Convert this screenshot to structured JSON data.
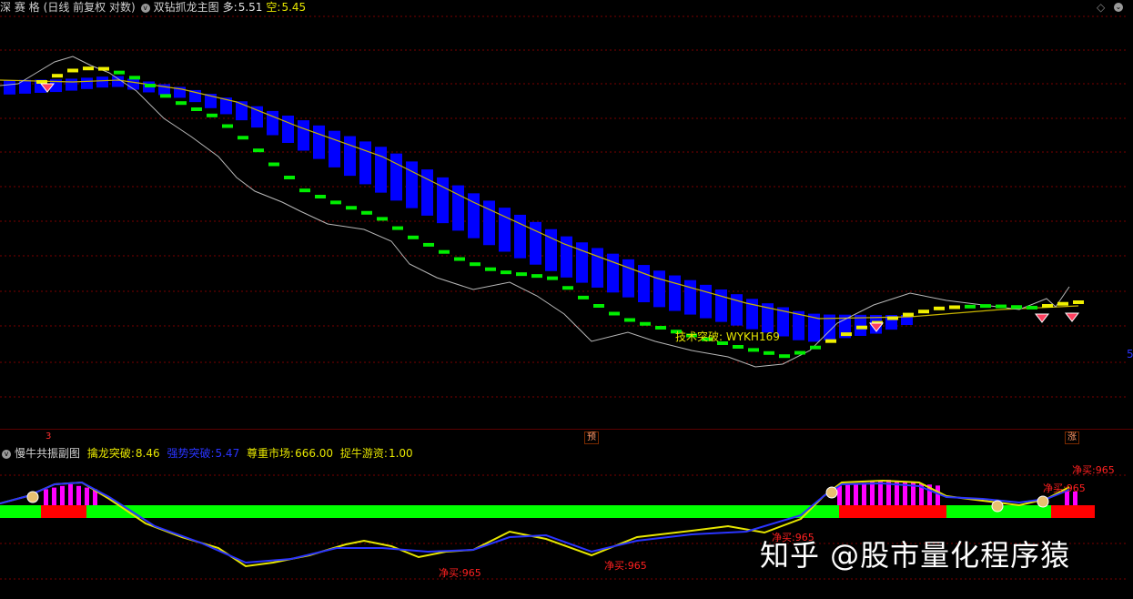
{
  "main_header": {
    "symbol_label": "深 赛 格",
    "mode_label": "(日线 前复权 对数)",
    "indicator_name": "双钻抓龙主图",
    "duo_label": "多:",
    "duo_value": "5.51",
    "kong_label": "空:",
    "kong_value": "5.45"
  },
  "sub_header": {
    "indicator_name": "慢牛共振副图",
    "items": [
      {
        "label": "擒龙突破:",
        "value": "8.46",
        "color": "#e6e600"
      },
      {
        "label": "强势突破:",
        "value": "5.47",
        "color": "#2a34ff"
      },
      {
        "label": "尊重市场:",
        "value": "666.00",
        "color": "#e6e600"
      },
      {
        "label": "捉牛游资:",
        "value": "1.00",
        "color": "#e6e600"
      }
    ]
  },
  "main_annotation": "技术突破: WYKH169",
  "sub_annotations": [
    {
      "text": "净买:965"
    },
    {
      "text": "净买:965"
    },
    {
      "text": "净买:965"
    },
    {
      "text": "净买:965"
    },
    {
      "text": "净买:965"
    }
  ],
  "axis_markers": [
    {
      "text": "3",
      "color": "#ff3030"
    },
    {
      "text": "预",
      "color": "#ff9a6a"
    },
    {
      "text": "涨",
      "color": "#ff9a6a"
    }
  ],
  "right_edge_label": "5",
  "watermark": "知乎 @股市量化程序猿",
  "colors": {
    "background": "#000000",
    "grid": "#7a0000",
    "bar": "#0000ff",
    "step_up": "#f0f000",
    "step_down": "#00ee00",
    "price_line": "#b8b8b8",
    "ma_line": "#c8b400",
    "sub_green": "#00ff00",
    "sub_red": "#ff0000",
    "sub_magenta": "#ff00ff",
    "sub_yellow": "#e6e600",
    "sub_blue": "#2a34ff",
    "annotation_red": "#ff2020"
  },
  "icons": {
    "header_menu": "circle-icon",
    "window_control": "diamond-icon",
    "buy_signal": "diamond-signal-icon",
    "money_bag": "money-bag-icon"
  }
}
